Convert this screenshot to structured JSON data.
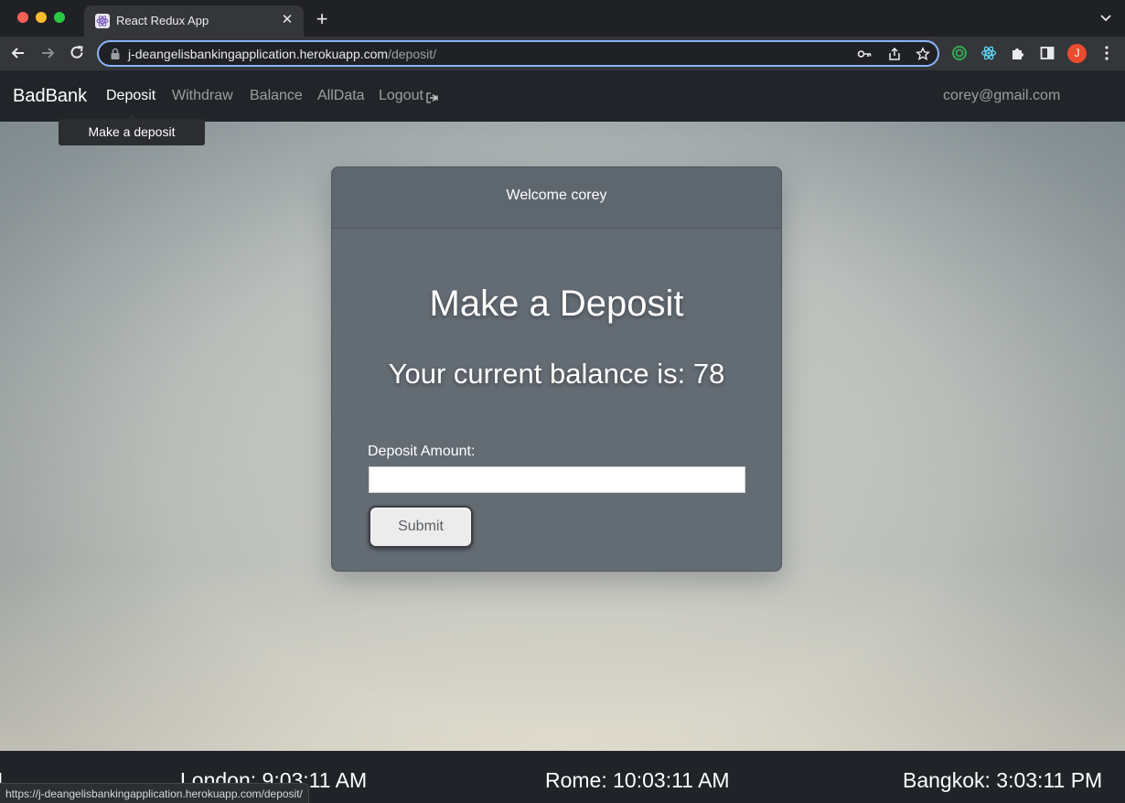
{
  "browser": {
    "tab_title": "React Redux App",
    "tab_close": "✕",
    "new_tab": "+",
    "url_host": "j-deangelisbankingapplication.herokuapp.com",
    "url_path": "/deposit/",
    "profile_initial": "J",
    "status_url": "https://j-deangelisbankingapplication.herokuapp.com/deposit/"
  },
  "nav": {
    "brand": "BadBank",
    "links": [
      "Deposit",
      "Withdraw",
      "Balance",
      "AllData",
      "Logout"
    ],
    "active": "Deposit",
    "user_email": "corey@gmail.com",
    "tooltip": "Make a deposit"
  },
  "card": {
    "header": "Welcome corey",
    "title": "Make a Deposit",
    "balance_text": "Your current balance is: 78",
    "field_label": "Deposit Amount:",
    "input_value": "",
    "submit_label": "Submit"
  },
  "clocks": [
    {
      "text": "M"
    },
    {
      "text": "London: 9:03:11 AM"
    },
    {
      "text": "Rome: 10:03:11 AM"
    },
    {
      "text": "Bangkok: 3:03:11 PM"
    }
  ],
  "colors": {
    "navbar": "#212529",
    "card": "#636b73",
    "accent_focus": "#8ab4f8",
    "profile": "#ea4a2e"
  },
  "icons": [
    "back-arrow-icon",
    "forward-arrow-icon",
    "reload-icon",
    "lock-icon",
    "key-icon",
    "share-icon",
    "star-icon",
    "extension-icon",
    "sidebar-icon",
    "kebab-menu-icon",
    "logout-icon"
  ]
}
